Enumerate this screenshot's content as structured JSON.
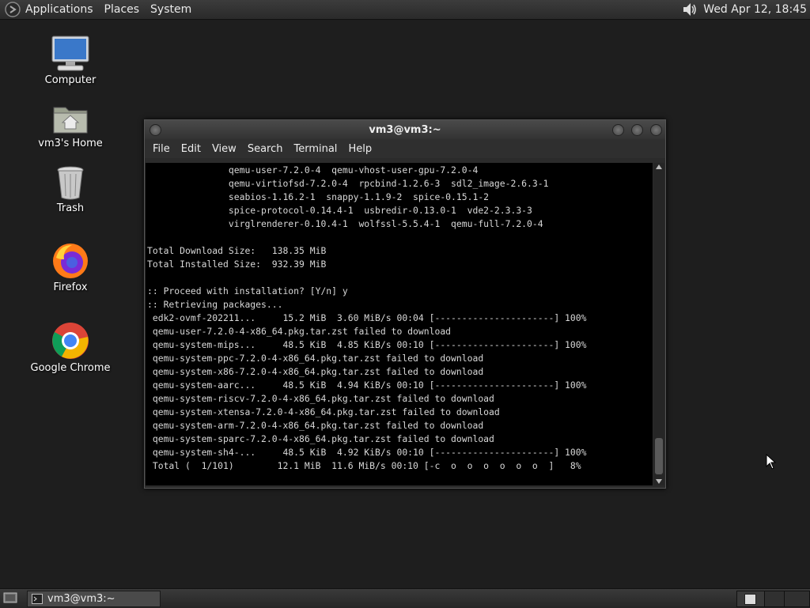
{
  "top_panel": {
    "menus": [
      "Applications",
      "Places",
      "System"
    ],
    "clock": "Wed Apr 12, 18:45"
  },
  "desktop": {
    "icons": [
      {
        "label": "Computer"
      },
      {
        "label": "vm3's Home"
      },
      {
        "label": "Trash"
      },
      {
        "label": "Firefox"
      },
      {
        "label": "Google Chrome"
      }
    ]
  },
  "window": {
    "title": "vm3@vm3:~",
    "menu": [
      "File",
      "Edit",
      "View",
      "Search",
      "Terminal",
      "Help"
    ],
    "terminal_text": "               qemu-user-7.2.0-4  qemu-vhost-user-gpu-7.2.0-4\n               qemu-virtiofsd-7.2.0-4  rpcbind-1.2.6-3  sdl2_image-2.6.3-1\n               seabios-1.16.2-1  snappy-1.1.9-2  spice-0.15.1-2\n               spice-protocol-0.14.4-1  usbredir-0.13.0-1  vde2-2.3.3-3\n               virglrenderer-0.10.4-1  wolfssl-5.5.4-1  qemu-full-7.2.0-4\n\nTotal Download Size:   138.35 MiB\nTotal Installed Size:  932.39 MiB\n\n:: Proceed with installation? [Y/n] y\n:: Retrieving packages...\n edk2-ovmf-202211...     15.2 MiB  3.60 MiB/s 00:04 [----------------------] 100%\n qemu-user-7.2.0-4-x86_64.pkg.tar.zst failed to download\n qemu-system-mips...     48.5 KiB  4.85 KiB/s 00:10 [----------------------] 100%\n qemu-system-ppc-7.2.0-4-x86_64.pkg.tar.zst failed to download\n qemu-system-x86-7.2.0-4-x86_64.pkg.tar.zst failed to download\n qemu-system-aarc...     48.5 KiB  4.94 KiB/s 00:10 [----------------------] 100%\n qemu-system-riscv-7.2.0-4-x86_64.pkg.tar.zst failed to download\n qemu-system-xtensa-7.2.0-4-x86_64.pkg.tar.zst failed to download\n qemu-system-arm-7.2.0-4-x86_64.pkg.tar.zst failed to download\n qemu-system-sparc-7.2.0-4-x86_64.pkg.tar.zst failed to download\n qemu-system-sh4-...     48.5 KiB  4.92 KiB/s 00:10 [----------------------] 100%\n Total (  1/101)        12.1 MiB  11.6 MiB/s 00:10 [-c  o  o  o  o  o  o  ]   8%"
  },
  "taskbar": {
    "task_label": "vm3@vm3:~"
  }
}
